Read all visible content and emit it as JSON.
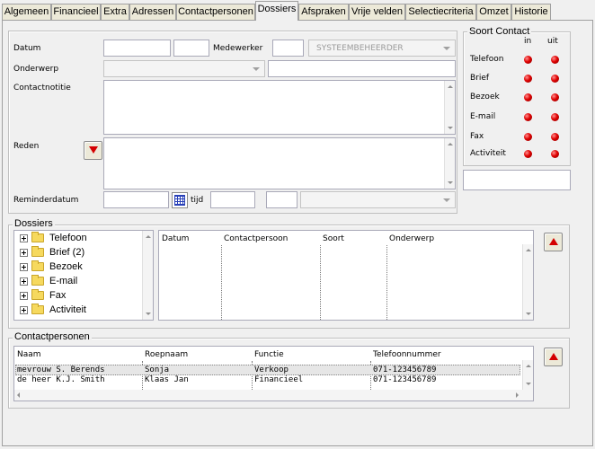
{
  "tabs": [
    "Algemeen",
    "Financieel",
    "Extra",
    "Adressen",
    "Contactpersonen",
    "Dossiers",
    "Afspraken",
    "Vrije velden",
    "Selectiecriteria",
    "Omzet",
    "Historie"
  ],
  "active_tab": "Dossiers",
  "form": {
    "datum_label": "Datum",
    "medewerker_label": "Medewerker",
    "medewerker_value": "SYSTEEMBEHEERDER",
    "onderwerp_label": "Onderwerp",
    "contactnotitie_label": "Contactnotitie",
    "reden_label": "Reden",
    "reminderdatum_label": "Reminderdatum",
    "tijd_label": "tijd"
  },
  "soort_contact": {
    "title": "Soort Contact",
    "in_label": "in",
    "uit_label": "uit",
    "rows": [
      "Telefoon",
      "Brief",
      "Bezoek",
      "E-mail",
      "Fax",
      "Activiteit"
    ],
    "led_color": "#e00000"
  },
  "dossiers": {
    "title": "Dossiers",
    "tree": [
      "Telefoon",
      "Brief (2)",
      "Bezoek",
      "E-mail",
      "Fax",
      "Activiteit"
    ],
    "columns": [
      "Datum",
      "Contactpersoon",
      "Soort",
      "Onderwerp"
    ]
  },
  "contactpersonen": {
    "title": "Contactpersonen",
    "columns": [
      "Naam",
      "Roepnaam",
      "Functie",
      "Telefoonnummer"
    ],
    "rows": [
      [
        "mevrouw S. Berends",
        "Sonja",
        "Verkoop",
        "071-123456789"
      ],
      [
        "de heer K.J. Smith",
        "Klaas Jan",
        "Financieel",
        "071-123456789"
      ]
    ]
  },
  "icons": [
    "folder-icon",
    "calendar-icon",
    "arrow-down-icon",
    "arrow-up-icon",
    "status-led-icon"
  ]
}
